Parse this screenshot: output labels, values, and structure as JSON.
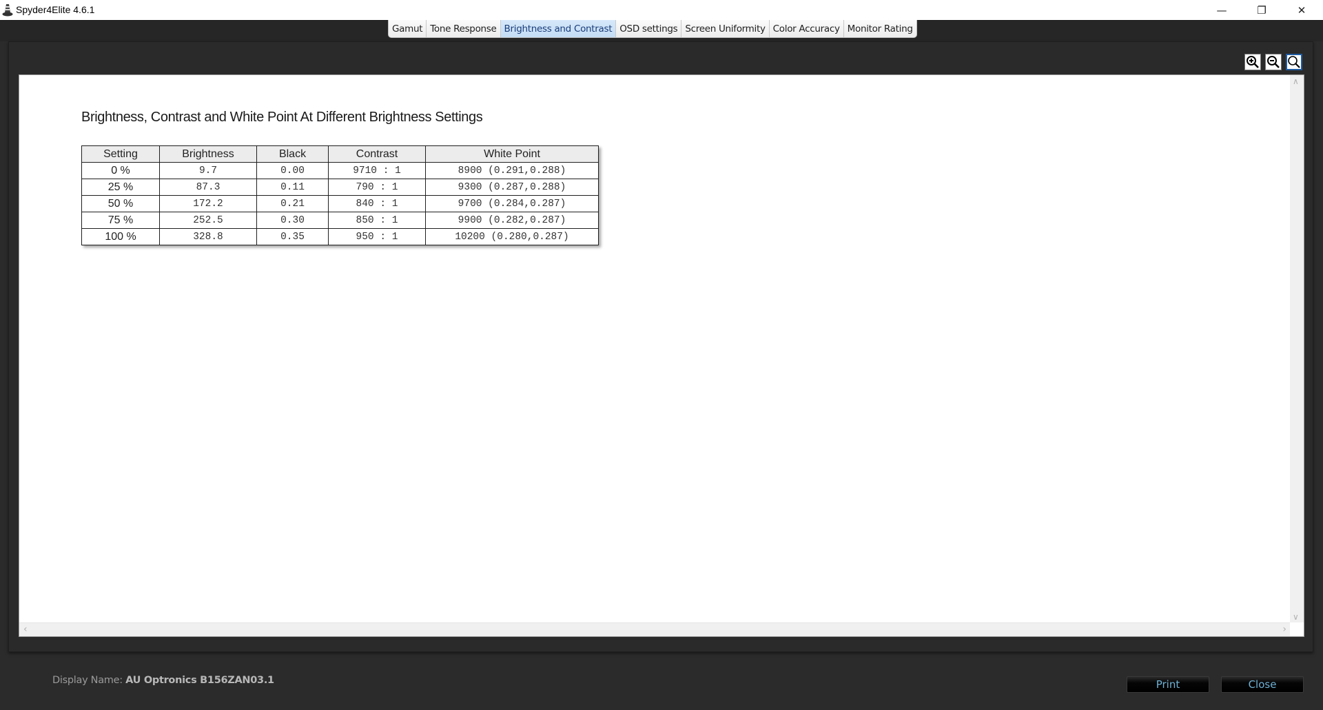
{
  "window": {
    "title": "Spyder4Elite 4.6.1",
    "controls": {
      "minimize": "—",
      "maximize": "❐",
      "close": "✕"
    }
  },
  "tabs": [
    {
      "label": "Gamut",
      "active": false
    },
    {
      "label": "Tone Response",
      "active": false
    },
    {
      "label": "Brightness and Contrast",
      "active": true
    },
    {
      "label": "OSD settings",
      "active": false
    },
    {
      "label": "Screen Uniformity",
      "active": false
    },
    {
      "label": "Color Accuracy",
      "active": false
    },
    {
      "label": "Monitor Rating",
      "active": false
    }
  ],
  "zoom_tools": [
    {
      "icon": "zoom-in-icon"
    },
    {
      "icon": "zoom-out-icon"
    },
    {
      "icon": "zoom-fit-icon",
      "active": true
    }
  ],
  "report": {
    "title": "Brightness, Contrast and White Point At Different Brightness Settings",
    "columns": [
      "Setting",
      "Brightness",
      "Black",
      "Contrast",
      "White Point"
    ],
    "rows": [
      {
        "setting": "0 %",
        "brightness": "9.7",
        "black": "0.00",
        "contrast": "9710 : 1",
        "white_point": "8900 (0.291,0.288)"
      },
      {
        "setting": "25 %",
        "brightness": "87.3",
        "black": "0.11",
        "contrast": "790 : 1",
        "white_point": "9300 (0.287,0.288)"
      },
      {
        "setting": "50 %",
        "brightness": "172.2",
        "black": "0.21",
        "contrast": "840 : 1",
        "white_point": "9700 (0.284,0.287)"
      },
      {
        "setting": "75 %",
        "brightness": "252.5",
        "black": "0.30",
        "contrast": "850 : 1",
        "white_point": "9900 (0.282,0.287)"
      },
      {
        "setting": "100 %",
        "brightness": "328.8",
        "black": "0.35",
        "contrast": "950 : 1",
        "white_point": "10200 (0.280,0.287)"
      }
    ]
  },
  "footer": {
    "display_name_label": "Display Name:",
    "display_name_value": "AU Optronics B156ZAN03.1",
    "print_label": "Print",
    "close_label": "Close"
  },
  "colors": {
    "active_tab": "#c4ddf5",
    "button_text": "#6fb2d6",
    "background": "#2b2b2b"
  }
}
